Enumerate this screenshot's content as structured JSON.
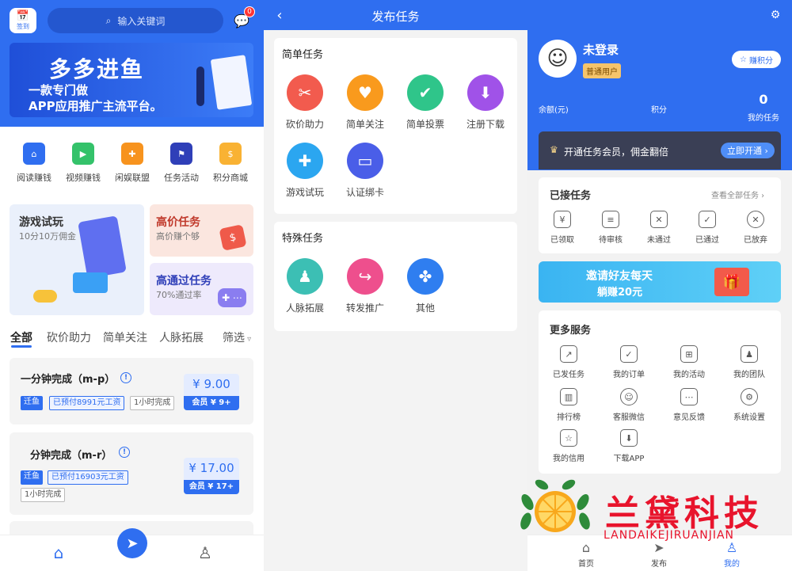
{
  "home": {
    "logo_label": "签到",
    "search_placeholder": "输入关键词",
    "msg_badge": "0",
    "banner": {
      "title": "多多进鱼",
      "line1": "一款专门做",
      "line2": "APP应用推广主流平台。"
    },
    "quick": [
      "阅读赚钱",
      "视频赚钱",
      "闲娱联盟",
      "任务活动",
      "积分商城"
    ],
    "promo": {
      "game": {
        "title": "游戏试玩",
        "sub": "10分10万佣金"
      },
      "high": {
        "title": "高价任务",
        "sub": "高价赚个够"
      },
      "pass": {
        "title": "高通过任务",
        "sub": "70%通过率"
      }
    },
    "tabs": [
      "全部",
      "砍价助力",
      "简单关注",
      "人脉拓展",
      "筛选"
    ],
    "tasks": [
      {
        "title": "一分钟完成（m-p）",
        "tag1": "迁鱼",
        "tag2": "已预付8991元工资",
        "tag3": "1小时完成",
        "price": "¥ 9.00",
        "vip": "会员 ¥ 9+"
      },
      {
        "title": "分钟完成（m-r）",
        "tag1": "迁鱼",
        "tag2": "已预付16903元工资",
        "tag3": "1小时完成",
        "price": "¥ 17.00",
        "vip": "会员 ¥ 17+"
      }
    ]
  },
  "publish": {
    "title": "发布任务",
    "simple_title": "简单任务",
    "simple": [
      "砍价助力",
      "简单关注",
      "简单投票",
      "注册下载",
      "游戏试玩",
      "认证绑卡"
    ],
    "special_title": "特殊任务",
    "special": [
      "人脉拓展",
      "转发推广",
      "其他"
    ]
  },
  "mine": {
    "name": "未登录",
    "level": "普通用户",
    "earn": "赚积分",
    "stats": [
      {
        "label": "余额(元)",
        "value": ""
      },
      {
        "label": "积分",
        "value": ""
      },
      {
        "label": "我的任务",
        "value": "0"
      }
    ],
    "vip_text": "开通任务会员，佣金翻倍",
    "vip_btn": "立即开通 ›",
    "accepted_title": "已接任务",
    "view_all": "查看全部任务 ›",
    "accepted": [
      "已领取",
      "待审核",
      "未通过",
      "已通过",
      "已放弃"
    ],
    "invite": {
      "line1": "邀请好友每天",
      "line2": "躺赚20元"
    },
    "more_title": "更多服务",
    "services": [
      "已发任务",
      "我的订单",
      "我的活动",
      "我的团队",
      "排行榜",
      "客服微信",
      "意见反馈",
      "系统设置",
      "我的信用",
      "下载APP"
    ],
    "tabbar": [
      "首页",
      "发布",
      "我的"
    ]
  },
  "watermark": {
    "cn": "兰黛科技",
    "en": "LANDAIKEJIRUANJIAN"
  },
  "colors": {
    "primary": "#2f6ef0"
  }
}
